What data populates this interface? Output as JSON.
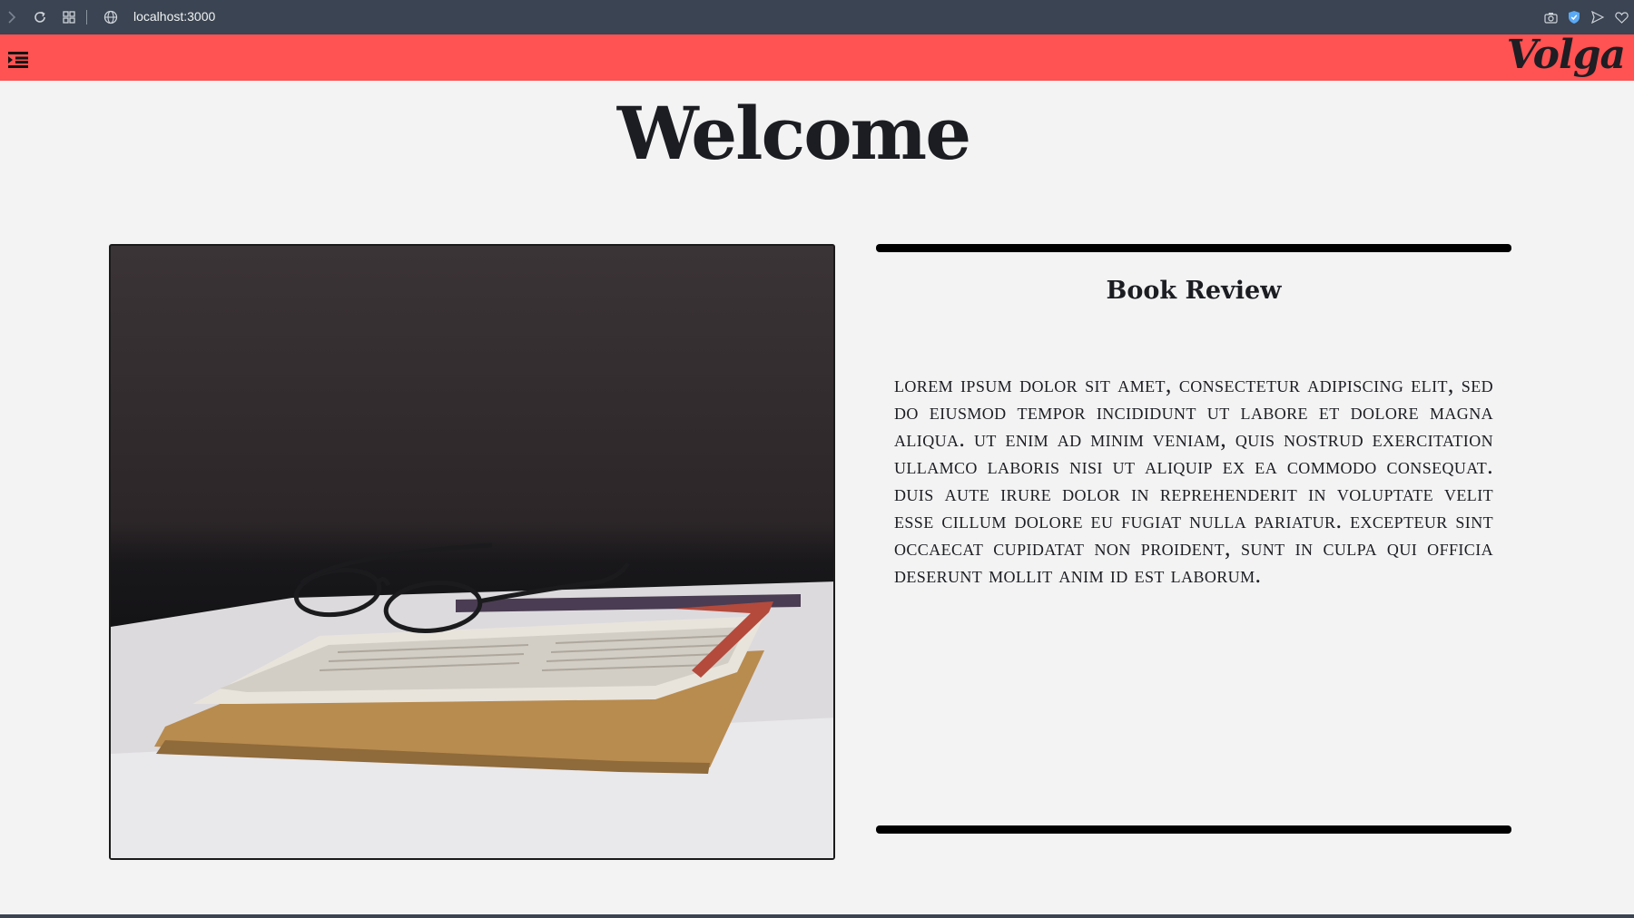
{
  "browser": {
    "url": "localhost:3000",
    "icons": [
      "forward-icon",
      "reload-icon",
      "tabs-grid-icon",
      "globe-icon",
      "camera-icon",
      "shield-icon",
      "send-icon",
      "heart-icon"
    ]
  },
  "header": {
    "brand": "Volga",
    "background": "#ff5252",
    "menu_icon": "menu-indent-icon"
  },
  "main": {
    "title": "Welcome",
    "image": {
      "description_icon": "book-with-glasses-photo"
    },
    "review": {
      "title": "Book Review",
      "body": "Lorem ipsum dolor sit amet, consectetur adipiscing elit, sed do eiusmod tempor incididunt ut labore et dolore magna aliqua. Ut enim ad minim veniam, quis nostrud exercitation ullamco laboris nisi ut aliquip ex ea commodo consequat. Duis aute irure dolor in reprehenderit in voluptate velit esse cillum dolore eu fugiat nulla pariatur. Excepteur sint occaecat cupidatat non proident, sunt in culpa qui officia deserunt mollit anim id est laborum."
    }
  }
}
